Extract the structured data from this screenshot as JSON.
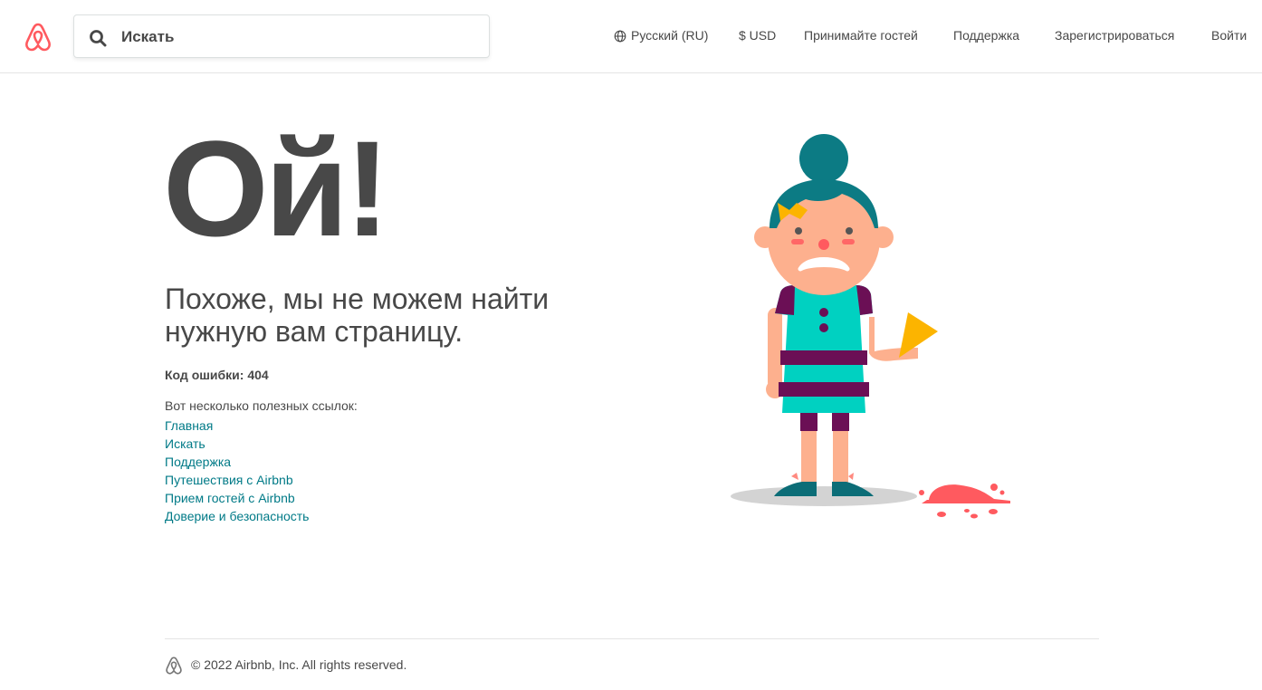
{
  "header": {
    "logo_icon": "airbnb-logo-icon",
    "search": {
      "icon": "search-icon",
      "placeholder": "Искать"
    },
    "nav": {
      "language": {
        "icon": "globe-icon",
        "label": "Русский (RU)"
      },
      "currency": "$ USD",
      "host": "Принимайте гостей",
      "help": "Поддержка",
      "signup": "Зарегистрироваться",
      "login": "Войти"
    }
  },
  "main": {
    "headline": "Ой!",
    "subtitle": "Похоже, мы не можем найти нужную вам страницу.",
    "error_code": "Код ошибки: 404",
    "links_intro": "Вот несколько полезных ссылок:",
    "links": [
      "Главная",
      "Искать",
      "Поддержка",
      "Путешествия с Airbnb",
      "Прием гостей с Airbnb",
      "Доверие и безопасность"
    ]
  },
  "footer": {
    "copyright": "© 2022 Airbnb, Inc. All rights reserved."
  },
  "colors": {
    "brand": "#ff5a5f",
    "link": "#007a87",
    "text": "#484848"
  }
}
